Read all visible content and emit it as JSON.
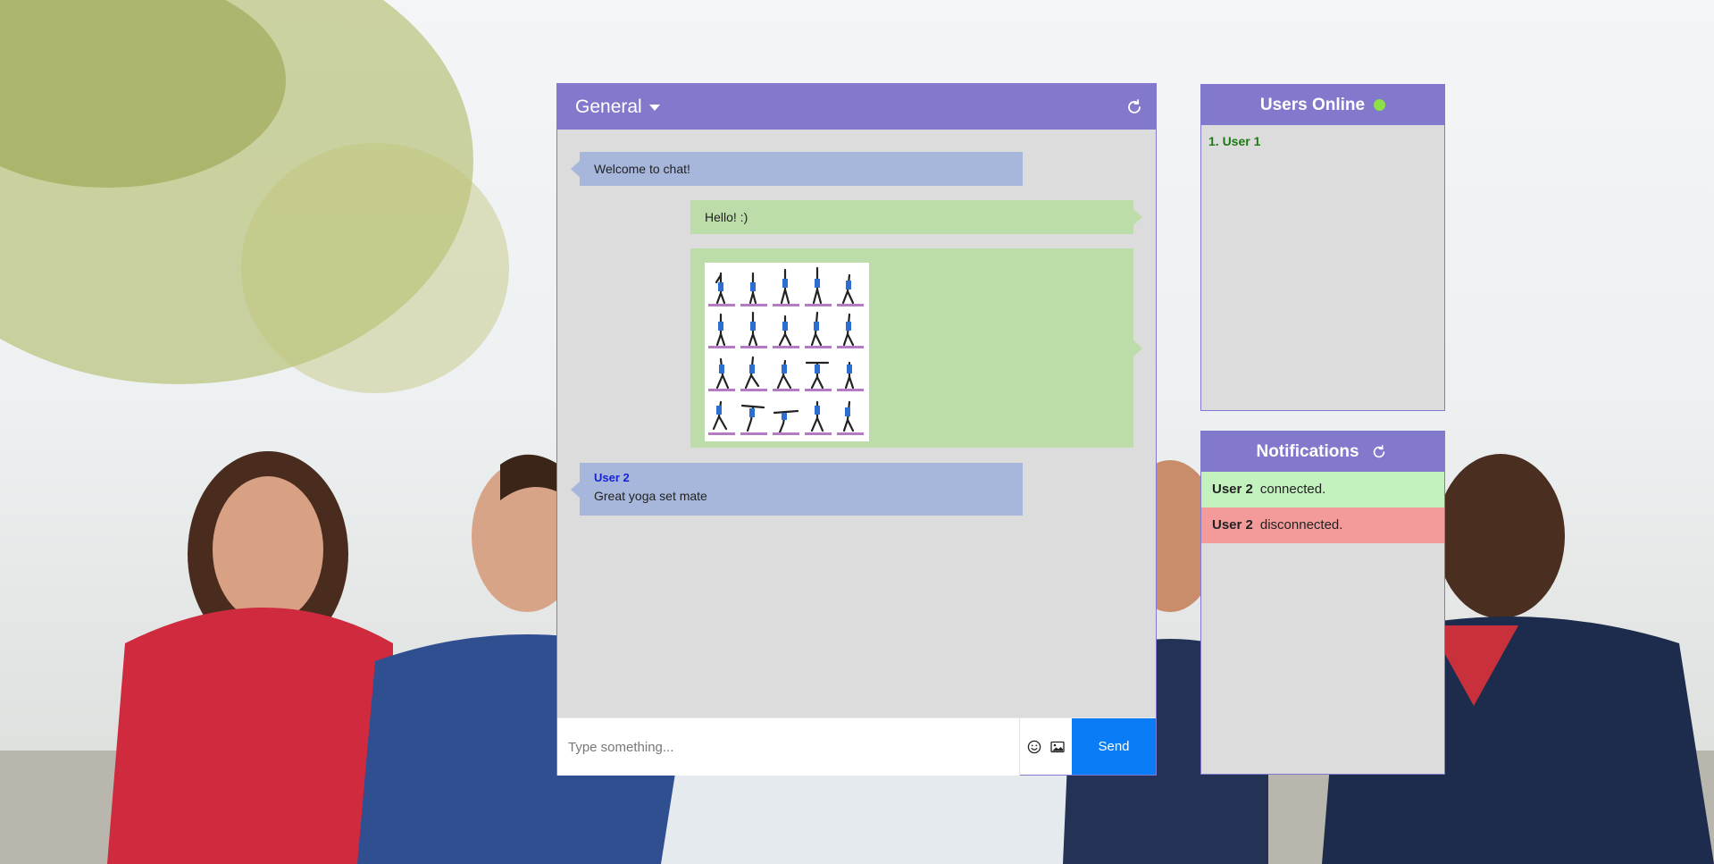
{
  "chat": {
    "room": "General",
    "messages": [
      {
        "direction": "in",
        "text": "Welcome to chat!"
      },
      {
        "direction": "out",
        "text": "Hello! :)"
      },
      {
        "direction": "out",
        "image": "yoga-poses-grid"
      },
      {
        "direction": "in",
        "sender": "User 2",
        "text": "Great yoga set mate"
      }
    ],
    "composer": {
      "placeholder": "Type something...",
      "send_label": "Send"
    }
  },
  "users_online": {
    "title": "Users Online",
    "status_color": "#8ee048",
    "users": [
      "1. User 1"
    ]
  },
  "notifications": {
    "title": "Notifications",
    "items": [
      {
        "user": "User 2",
        "text": "connected.",
        "status": "connected",
        "color": "#c3f2bf"
      },
      {
        "user": "User 2",
        "text": "disconnected.",
        "status": "disconnected",
        "color": "#f39b9a"
      }
    ]
  },
  "colors": {
    "header": "#8279cc",
    "panel": "#dcdcdc",
    "incoming_bubble": "#a7b7dc",
    "outgoing_bubble": "#bcdda9",
    "send_button": "#0a7cf5",
    "sender_name": "#1722d6",
    "online_user": "#1b7a14"
  },
  "icons": [
    "caret-down-icon",
    "refresh-icon",
    "emoji-icon",
    "image-icon",
    "online-status-icon"
  ]
}
